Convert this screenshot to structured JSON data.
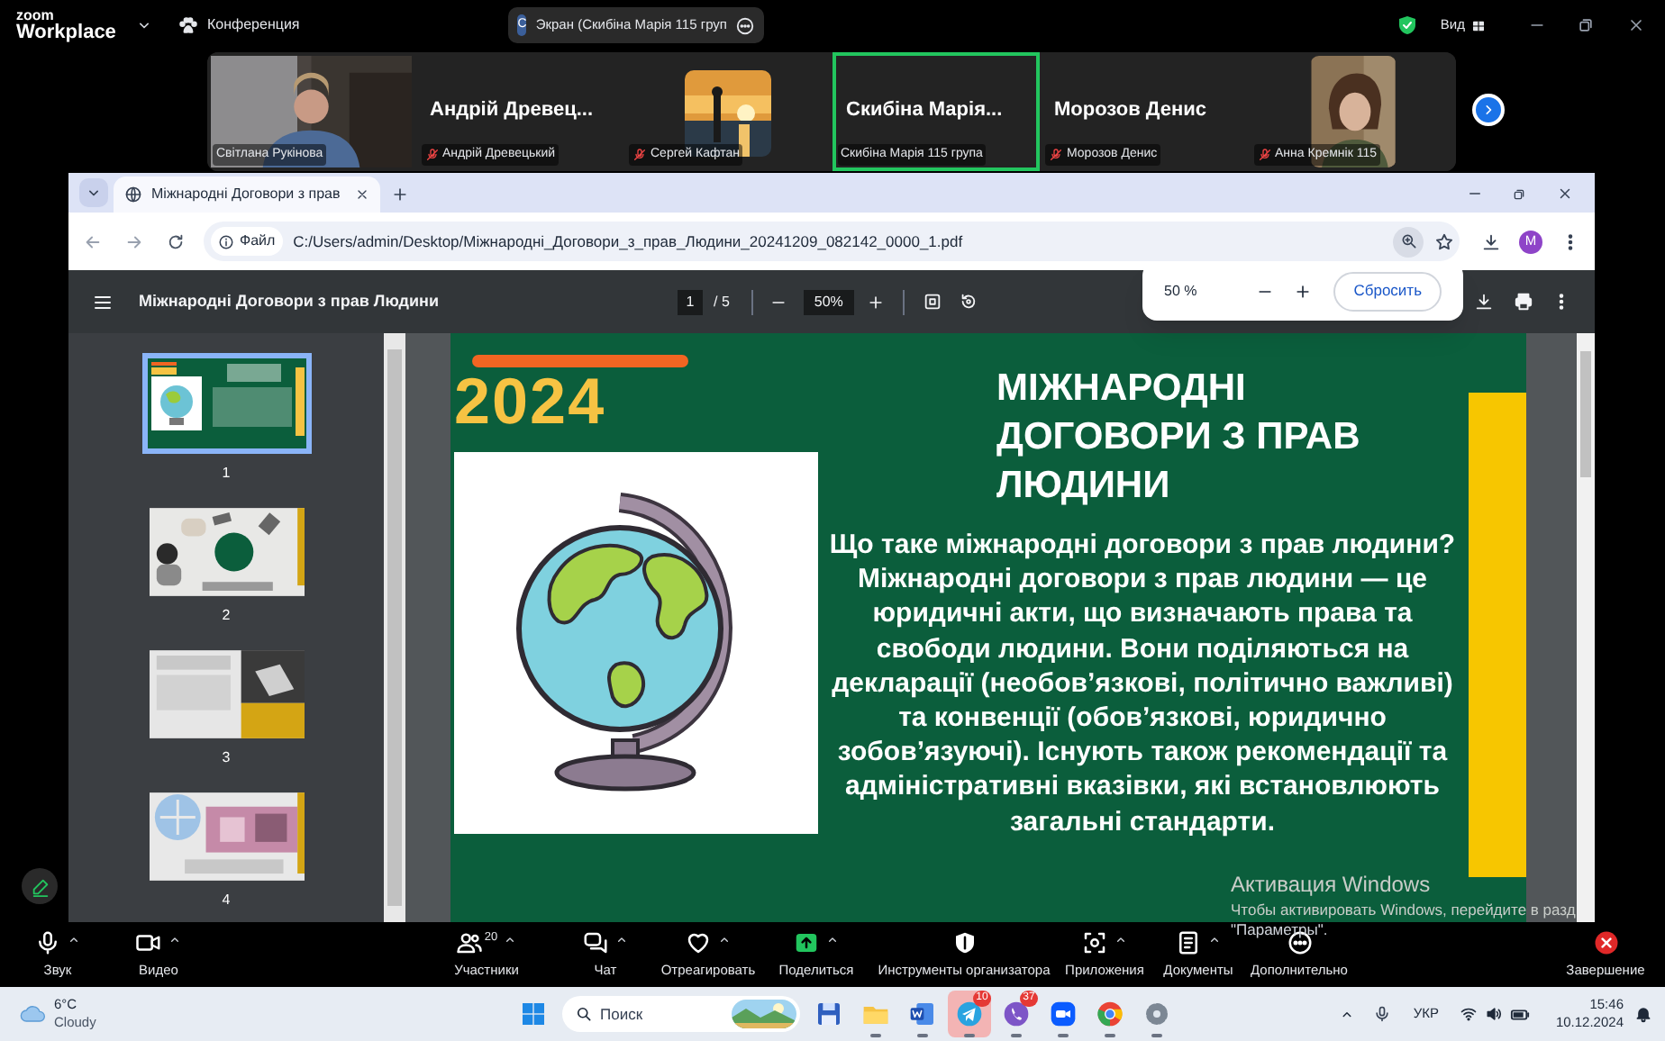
{
  "zoom_top_bar": {
    "logo_top": "zoom",
    "logo_bottom": "Workplace",
    "meeting_label": "Конференция",
    "share_pill": {
      "avatar": "С",
      "label": "Экран (Скибіна Марія 115 груп"
    },
    "view_label": "Вид"
  },
  "video_tiles": [
    {
      "kind": "video",
      "name_label": "Світлана Рукінова",
      "muted": false,
      "speaking": false
    },
    {
      "kind": "name",
      "display_name": "Андрій Древец...",
      "name_label": "Андрій Древецький",
      "muted": true,
      "speaking": false
    },
    {
      "kind": "avatar",
      "name_label": "Сергей Кафтан",
      "muted": true,
      "speaking": false
    },
    {
      "kind": "name",
      "display_name": "Скибіна Марія...",
      "name_label": "Скибіна Марія 115 група",
      "muted": false,
      "speaking": true
    },
    {
      "kind": "name",
      "display_name": "Морозов Денис",
      "name_label": "Морозов Денис",
      "muted": true,
      "speaking": false
    },
    {
      "kind": "avatar",
      "name_label": "Анна Кремнік 115",
      "muted": true,
      "speaking": false
    }
  ],
  "browser": {
    "tab_title": "Міжнародні Договори з прав",
    "address_chip": "Файл",
    "url": "C:/Users/admin/Desktop/Міжнародні_Договори_з_прав_Людини_20241209_082142_0000_1.pdf",
    "profile_initial": "M"
  },
  "pdf_toolbar": {
    "title": "Міжнародні Договори з прав Людини",
    "page": "1",
    "page_total": "/ 5",
    "zoom": "50%"
  },
  "zoom_popup": {
    "value": "50 %",
    "reset": "Сбросить"
  },
  "thumbnails": [
    {
      "number": "1",
      "selected": true
    },
    {
      "number": "2",
      "selected": false
    },
    {
      "number": "3",
      "selected": false
    },
    {
      "number": "4",
      "selected": false
    }
  ],
  "slide": {
    "year": "2024",
    "title": "МІЖНАРОДНІ ДОГОВОРИ З ПРАВ ЛЮДИНИ",
    "body": "Що таке міжнародні договори з прав людини? Міжнародні договори з прав людини — це юридичні акти, що визначають права та свободи людини. Вони поділяються на декларації (необовʼязкові, політично важливі) та конвенції (обовʼязкові, юридично зобовʼязуючі). Існують також рекомендації та адміністративні вказівки, які встановлюють загальні стандарти."
  },
  "windows_activation": {
    "title": "Активация Windows",
    "line_1": "Чтобы активировать Windows, перейдите в разд",
    "line_2": "\"Параметры\"."
  },
  "meeting_controls": [
    {
      "kind": "mic",
      "label": "Звук",
      "caret": true
    },
    {
      "kind": "camera",
      "label": "Видео",
      "caret": true
    },
    {
      "kind": "participants",
      "label": "Участники",
      "count": "20",
      "caret": true
    },
    {
      "kind": "chat",
      "label": "Чат",
      "caret": true
    },
    {
      "kind": "react",
      "label": "Отреагировать",
      "caret": true
    },
    {
      "kind": "share",
      "label": "Поделиться",
      "caret": true
    },
    {
      "kind": "host-tools",
      "label": "Инструменты организатора",
      "caret": false
    },
    {
      "kind": "apps",
      "label": "Приложения",
      "caret": true
    },
    {
      "kind": "docs",
      "label": "Документы",
      "caret": true
    },
    {
      "kind": "more",
      "label": "Дополнительно",
      "caret": false
    },
    {
      "kind": "end",
      "label": "Завершение",
      "caret": false
    }
  ],
  "taskbar": {
    "weather": {
      "temperature": "6°C",
      "condition": "Cloudy"
    },
    "search_placeholder": "Поиск",
    "apps": [
      {
        "kind": "floppy",
        "running": false,
        "highlighted": false
      },
      {
        "kind": "folder",
        "running": true,
        "highlighted": false
      },
      {
        "kind": "word",
        "running": true,
        "highlighted": false
      },
      {
        "kind": "telegram",
        "running": true,
        "highlighted": true,
        "badge": "10"
      },
      {
        "kind": "viber",
        "running": true,
        "highlighted": false,
        "badge": "37"
      },
      {
        "kind": "zoom",
        "running": true,
        "highlighted": false
      },
      {
        "kind": "chrome",
        "running": true,
        "highlighted": false
      },
      {
        "kind": "settings",
        "running": true,
        "highlighted": false
      }
    ],
    "language": "УКР",
    "time": "15:46",
    "date": "10.12.2024"
  }
}
